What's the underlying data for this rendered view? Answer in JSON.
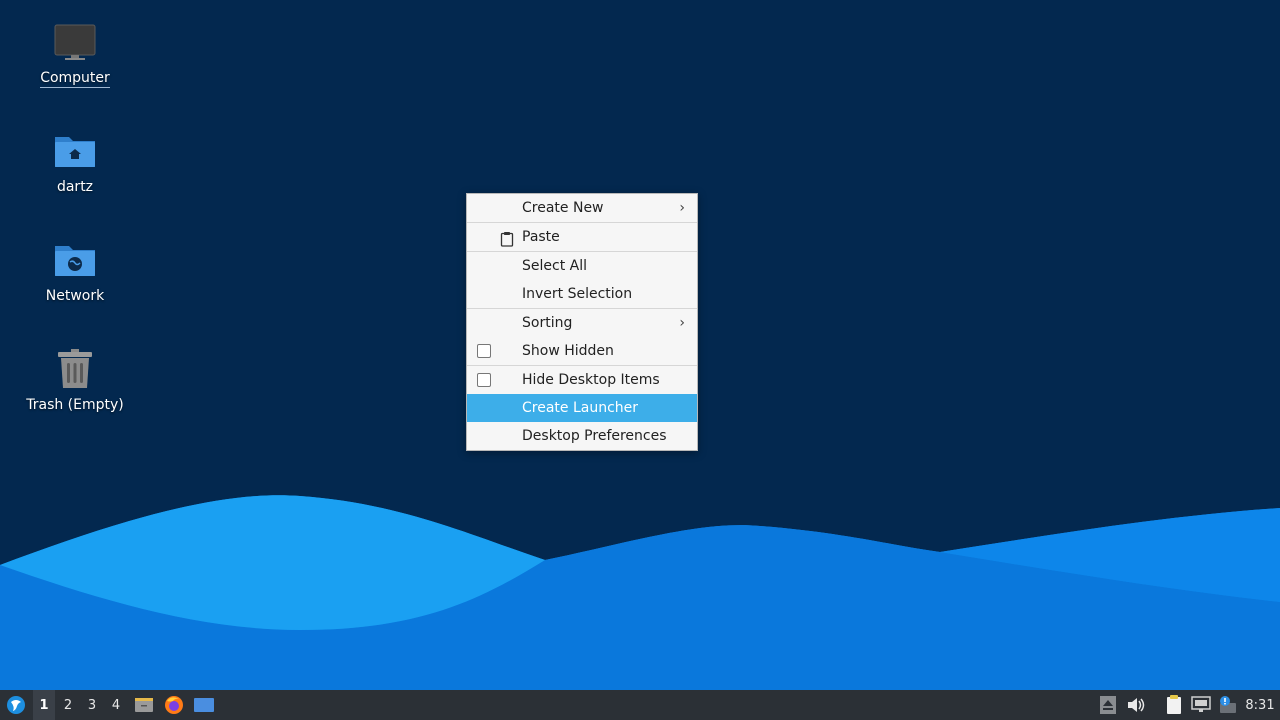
{
  "desktop": {
    "icons": [
      {
        "label": "Computer",
        "icon": "monitor-icon"
      },
      {
        "label": "dartz",
        "icon": "home-folder-icon"
      },
      {
        "label": "Network",
        "icon": "network-folder-icon"
      },
      {
        "label": "Trash (Empty)",
        "icon": "trash-icon"
      }
    ]
  },
  "context_menu": {
    "items": [
      {
        "label": "Create New",
        "submenu": true
      },
      {
        "label": "Paste",
        "icon": "clipboard-icon"
      },
      {
        "label": "Select All"
      },
      {
        "label": "Invert Selection"
      },
      {
        "label": "Sorting",
        "submenu": true
      },
      {
        "label": "Show Hidden",
        "checkbox": true,
        "checked": false
      },
      {
        "label": "Hide Desktop Items",
        "checkbox": true,
        "checked": false
      },
      {
        "label": "Create Launcher",
        "highlighted": true
      },
      {
        "label": "Desktop Preferences"
      }
    ]
  },
  "taskbar": {
    "workspaces": [
      "1",
      "2",
      "3",
      "4"
    ],
    "active_workspace": "1",
    "launchers": [
      "file-manager-icon",
      "firefox-icon",
      "show-desktop-icon"
    ],
    "tray": [
      "eject-icon",
      "volume-icon",
      "clipboard-manager-icon",
      "network-icon",
      "notification-icon"
    ],
    "clock": "8:31"
  },
  "colors": {
    "desktop_background": "#03284f",
    "wave_light": "#1a9af0",
    "wave_mid": "#0b7fe6",
    "menu_highlight": "#3daee9",
    "taskbar": "#2b3036"
  }
}
